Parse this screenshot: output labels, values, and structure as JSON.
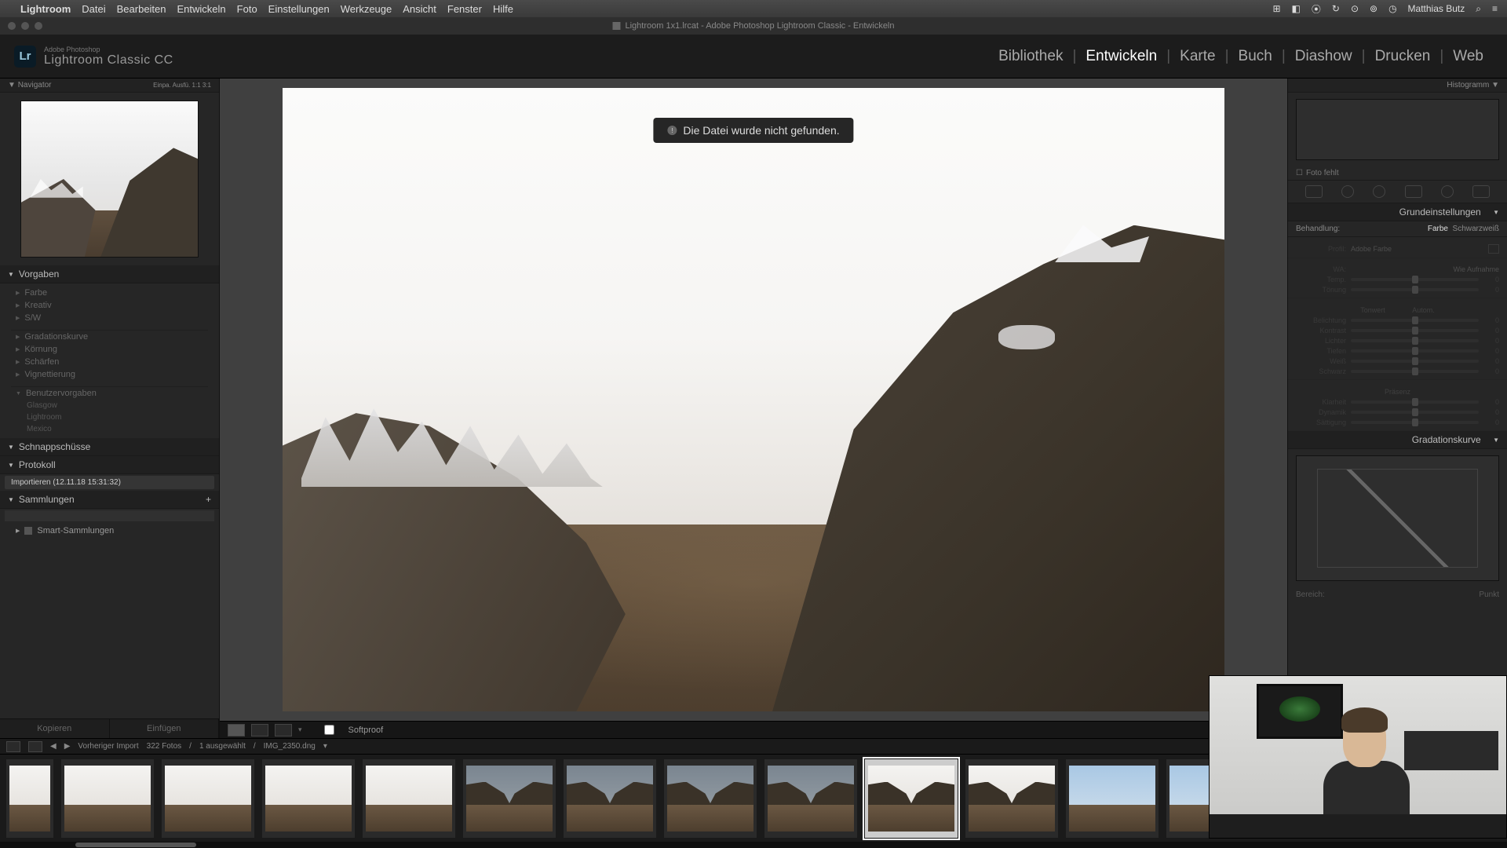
{
  "mac_menu": {
    "app": "Lightroom",
    "items": [
      "Datei",
      "Bearbeiten",
      "Entwickeln",
      "Foto",
      "Einstellungen",
      "Werkzeuge",
      "Ansicht",
      "Fenster",
      "Hilfe"
    ],
    "user": "Matthias Butz"
  },
  "window_title": "Lightroom 1x1.lrcat - Adobe Photoshop Lightroom Classic - Entwickeln",
  "brand": {
    "small": "Adobe Photoshop",
    "big": "Lightroom Classic CC"
  },
  "modules": {
    "items": [
      "Bibliothek",
      "Entwickeln",
      "Karte",
      "Buch",
      "Diashow",
      "Drucken",
      "Web"
    ],
    "active": "Entwickeln"
  },
  "left": {
    "navigator": {
      "title": "Navigator",
      "modes": "Einpa.   Ausfü.   1:1   3:1"
    },
    "presets": {
      "title": "Vorgaben",
      "groups": [
        "Farbe",
        "Kreativ",
        "S/W"
      ],
      "groups2": [
        "Gradationskurve",
        "Körnung",
        "Schärfen",
        "Vignettierung"
      ],
      "user_group": "Benutzervorgaben",
      "user_items": [
        "Glasgow",
        "Lightroom",
        "Mexico"
      ]
    },
    "snapshots": "Schnappschüsse",
    "history": {
      "title": "Protokoll",
      "entry": "Importieren (12.11.18 15:31:32)"
    },
    "collections": {
      "title": "Sammlungen",
      "smart": "Smart-Sammlungen"
    },
    "bottom": {
      "copy": "Kopieren",
      "paste": "Einfügen"
    }
  },
  "right": {
    "histogram": "Histogramm",
    "foto_fehlt": "Foto fehlt",
    "basic": {
      "title": "Grundeinstellungen",
      "treatment_label": "Behandlung:",
      "treatment_color": "Farbe",
      "treatment_bw": "Schwarzweiß",
      "profile_label": "Profil:",
      "profile_value": "Adobe Farbe",
      "wb_label": "WA:",
      "wb_value": "Wie Aufnahme",
      "sliders_wb": [
        "Temp.",
        "Tönung"
      ],
      "tone_title": "Tonwert",
      "auto": "Autom.",
      "sliders_tone": [
        "Belichtung",
        "Kontrast",
        "Lichter",
        "Tiefen",
        "Weiß",
        "Schwarz"
      ],
      "presence_title": "Präsenz",
      "sliders_presence": [
        "Klarheit",
        "Dynamik",
        "Sättigung"
      ]
    },
    "curve": {
      "title": "Gradationskurve",
      "region": "Bereich:",
      "point": "Punkt"
    }
  },
  "error_message": "Die Datei wurde nicht gefunden.",
  "toolbar": {
    "softproof": "Softproof"
  },
  "filmstrip": {
    "source_label": "Vorheriger Import",
    "count": "322 Fotos",
    "selected": "1 ausgewählt",
    "filename": "IMG_2350.dng"
  }
}
